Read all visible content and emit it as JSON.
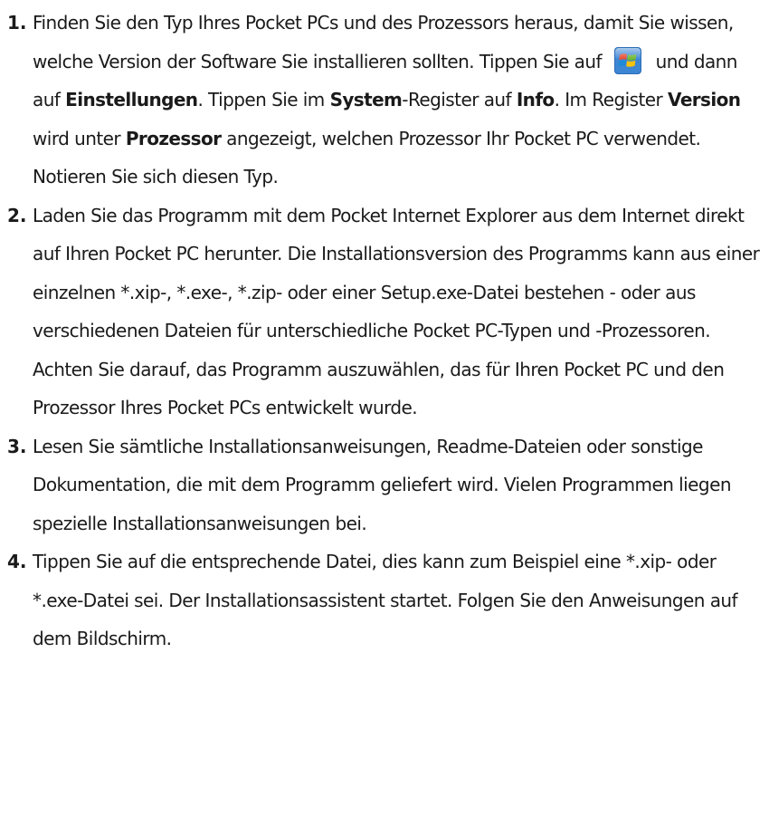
{
  "steps": [
    {
      "number": "1.",
      "text_a": "Finden Sie den Typ Ihres Pocket PCs und des Prozessors heraus, damit Sie wissen, welche Version der Software Sie installieren sollten. Tippen Sie auf",
      "text_b": " und dann auf ",
      "bold_settings": "Einstellungen",
      "text_c": ". Tippen Sie im ",
      "bold_system": "System",
      "text_d": "-Register auf ",
      "bold_info": "Info",
      "text_e": ". Im Register ",
      "bold_version": "Version",
      "text_f": " wird unter ",
      "bold_processor": "Prozessor",
      "text_g": " angezeigt, welchen Prozessor Ihr Pocket PC verwendet. Notieren Sie sich diesen Typ.",
      "icon": "windows-start-icon"
    },
    {
      "number": "2.",
      "text": "Laden Sie das Programm mit dem Pocket Internet Explorer aus dem Internet direkt auf Ihren Pocket PC herunter. Die Installationsversion des Programms kann aus einer einzelnen *.xip-, *.exe-, *.zip- oder einer Setup.exe-Datei bestehen - oder aus verschiedenen Dateien für unterschiedliche Pocket PC-Typen und -Prozessoren. Achten Sie darauf, das Programm auszuwählen, das für Ihren Pocket PC und den Prozessor Ihres Pocket PCs entwickelt wurde."
    },
    {
      "number": "3.",
      "text": "Lesen Sie sämtliche Installationsanweisungen, Readme-Dateien oder sonstige Dokumentation, die mit dem Programm geliefert wird. Vielen Programmen liegen spezielle Installationsanweisungen bei."
    },
    {
      "number": "4.",
      "text": "Tippen Sie auf die entsprechende Datei, dies kann zum Beispiel eine *.xip- oder *.exe-Datei sei. Der Installationsassistent startet. Folgen Sie den Anweisungen auf dem Bildschirm."
    }
  ],
  "colors": {
    "text": "#1a1a1a",
    "background": "#ffffff",
    "icon_red": "#e8462a",
    "icon_green": "#6cb52d",
    "icon_blue": "#1f8ad6",
    "icon_yellow": "#f7c20c"
  }
}
